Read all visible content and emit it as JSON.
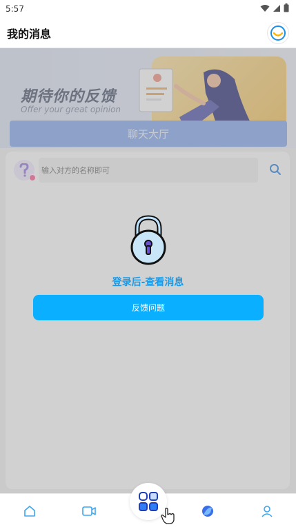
{
  "status_bar": {
    "time": "5:57"
  },
  "header": {
    "title": "我的消息"
  },
  "banner": {
    "title": "期待你的反馈",
    "subtitle": "Offer your great opinion",
    "chat_hall_label": "聊天大厅"
  },
  "search": {
    "placeholder": "输入对方的名称即可"
  },
  "locked": {
    "message": "登录后-查看消息",
    "feedback_label": "反馈问题"
  },
  "nav": {
    "items": [
      "home-icon",
      "video-icon",
      "apps-icon",
      "planet-icon",
      "profile-icon"
    ]
  },
  "colors": {
    "accent": "#0ab0ff",
    "message_text": "#1a9bea",
    "chat_hall": "#8fb1f2"
  }
}
